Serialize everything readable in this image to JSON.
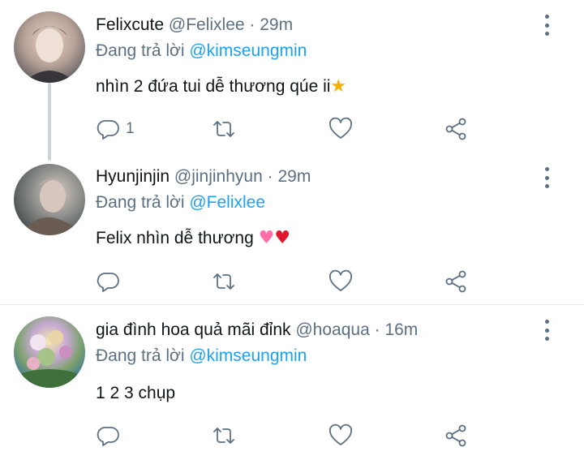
{
  "tweets": [
    {
      "name": "Felixcute",
      "handle": "@Felixlee",
      "time": "29m",
      "reply_prefix": "Đang trả lời",
      "reply_mention": "@kimseungmin",
      "text": "nhìn 2 đứa tui dễ thương qúe ii",
      "emoji": [
        "star-struck"
      ],
      "reply_count": "1"
    },
    {
      "name": "Hyunjinjin",
      "handle": "@jinjinhyun",
      "time": "29m",
      "reply_prefix": "Đang trả lời",
      "reply_mention": "@Felixlee",
      "text": "Felix nhìn dễ thương",
      "emoji": [
        "growing-heart",
        "red-heart"
      ],
      "reply_count": ""
    },
    {
      "name": "gia đình hoa quả mãi đỉnk",
      "handle": "@hoaqua",
      "time": "16m",
      "reply_prefix": "Đang trả lời",
      "reply_mention": "@kimseungmin",
      "text": "1 2 3 chụp",
      "emoji": [],
      "reply_count": ""
    }
  ],
  "separator": "·",
  "colors": {
    "text": "#0f1419",
    "muted": "#5b7083",
    "link": "#1da1f2",
    "thread_line": "#ced5da"
  }
}
